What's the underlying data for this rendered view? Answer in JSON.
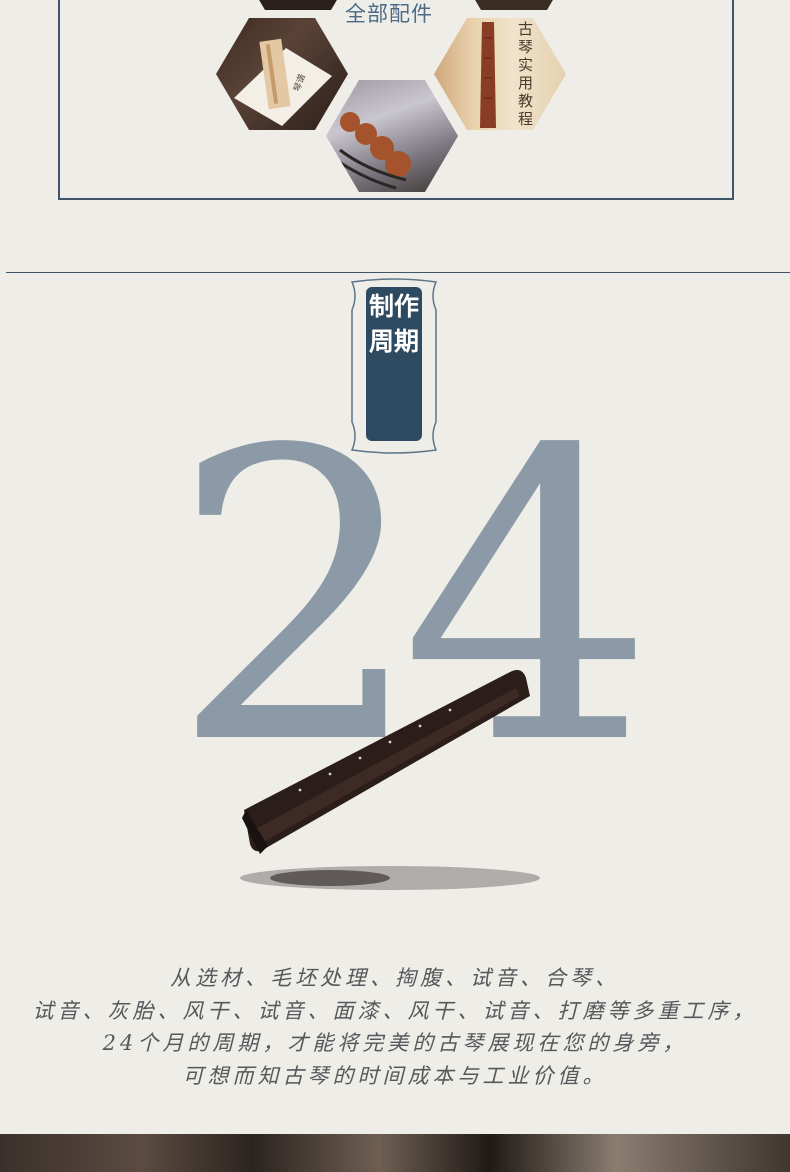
{
  "accessories": {
    "title": "全部配件",
    "book_spine": "古琴实用教程",
    "pouch_label": "琴谱"
  },
  "section_badge": {
    "label": "制作周期"
  },
  "cycle": {
    "number": "24"
  },
  "description": {
    "lines": [
      "从选材、毛坯处理、掏腹、试音、合琴、",
      "试音、灰胎、风干、试音、面漆、风干、试音、打磨等多重工序，",
      "24个月的周期，才能将完美的古琴展现在您的身旁，",
      "可想而知古琴的时间成本与工业价值。"
    ]
  },
  "colors": {
    "background": "#efede8",
    "accent_navy": "#2d4a60",
    "number_gray": "#8b9aa6"
  }
}
